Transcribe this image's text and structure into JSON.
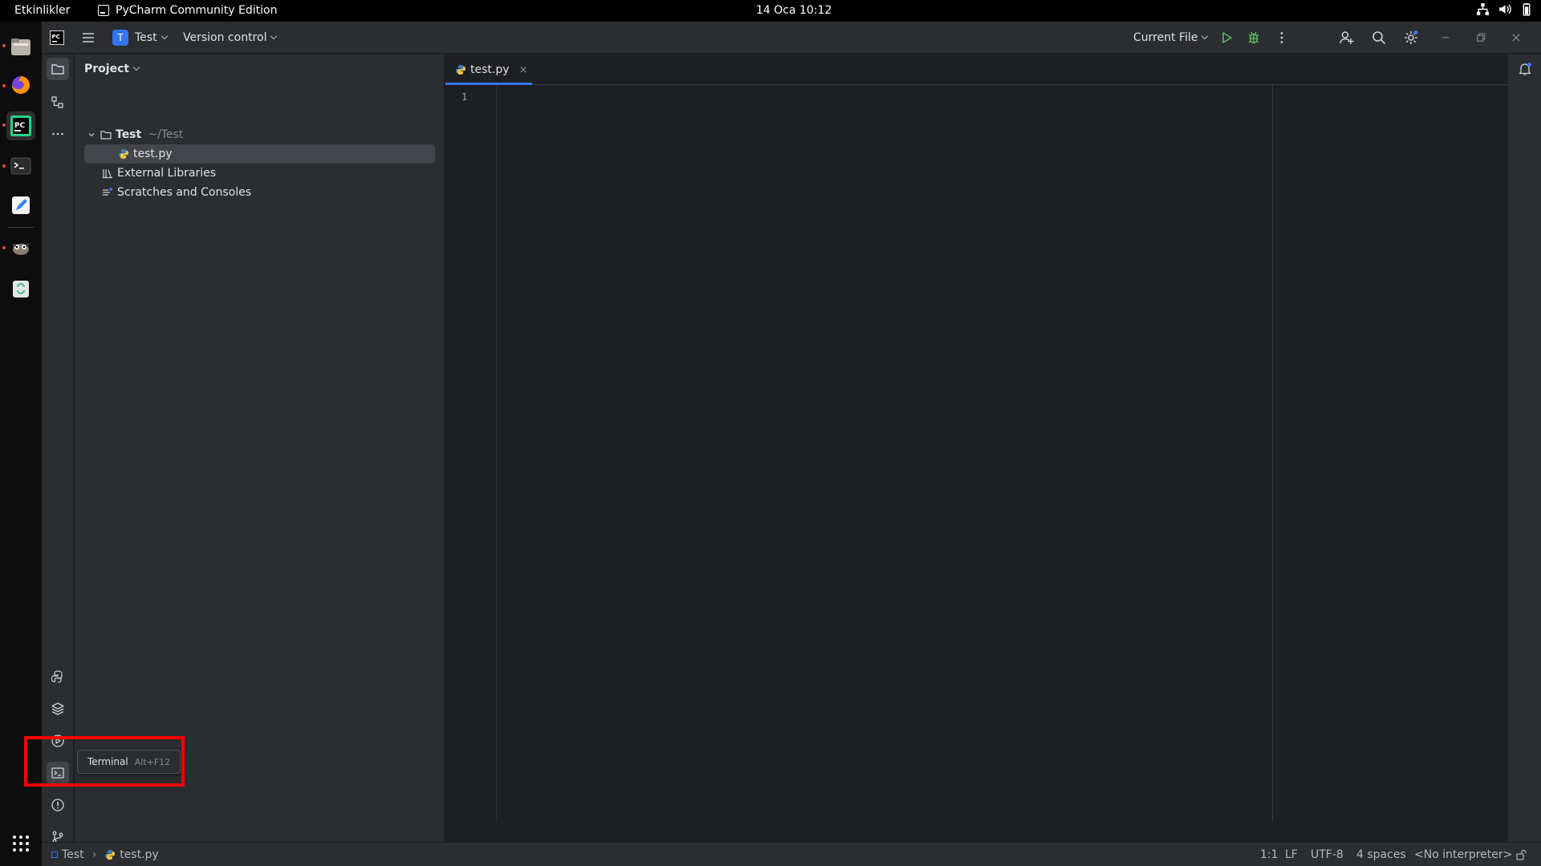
{
  "gnome": {
    "activities": "Etkinlikler",
    "app_name": "PyCharm Community Edition",
    "clock": "14 Oca  10:12"
  },
  "header": {
    "project_badge": "T",
    "project_name": "Test",
    "vcs_label": "Version control",
    "run_config": "Current File"
  },
  "project_panel": {
    "title": "Project",
    "tree": {
      "root_name": "Test",
      "root_path": "~/Test",
      "file": "test.py",
      "external": "External Libraries",
      "scratches": "Scratches and Consoles"
    }
  },
  "editor": {
    "tab_label": "test.py",
    "tab_close": "×",
    "line_number": "1"
  },
  "tooltip": {
    "label": "Terminal",
    "shortcut": "Alt+F12"
  },
  "status": {
    "breadcrumb_project": "Test",
    "breadcrumb_file": "test.py",
    "position": "1:1",
    "line_sep": "LF",
    "encoding": "UTF-8",
    "indent": "4 spaces",
    "interpreter": "<No interpreter>"
  },
  "colors": {
    "accent": "#3574f0",
    "highlight": "#ff0000",
    "run_green": "#5fb865"
  }
}
